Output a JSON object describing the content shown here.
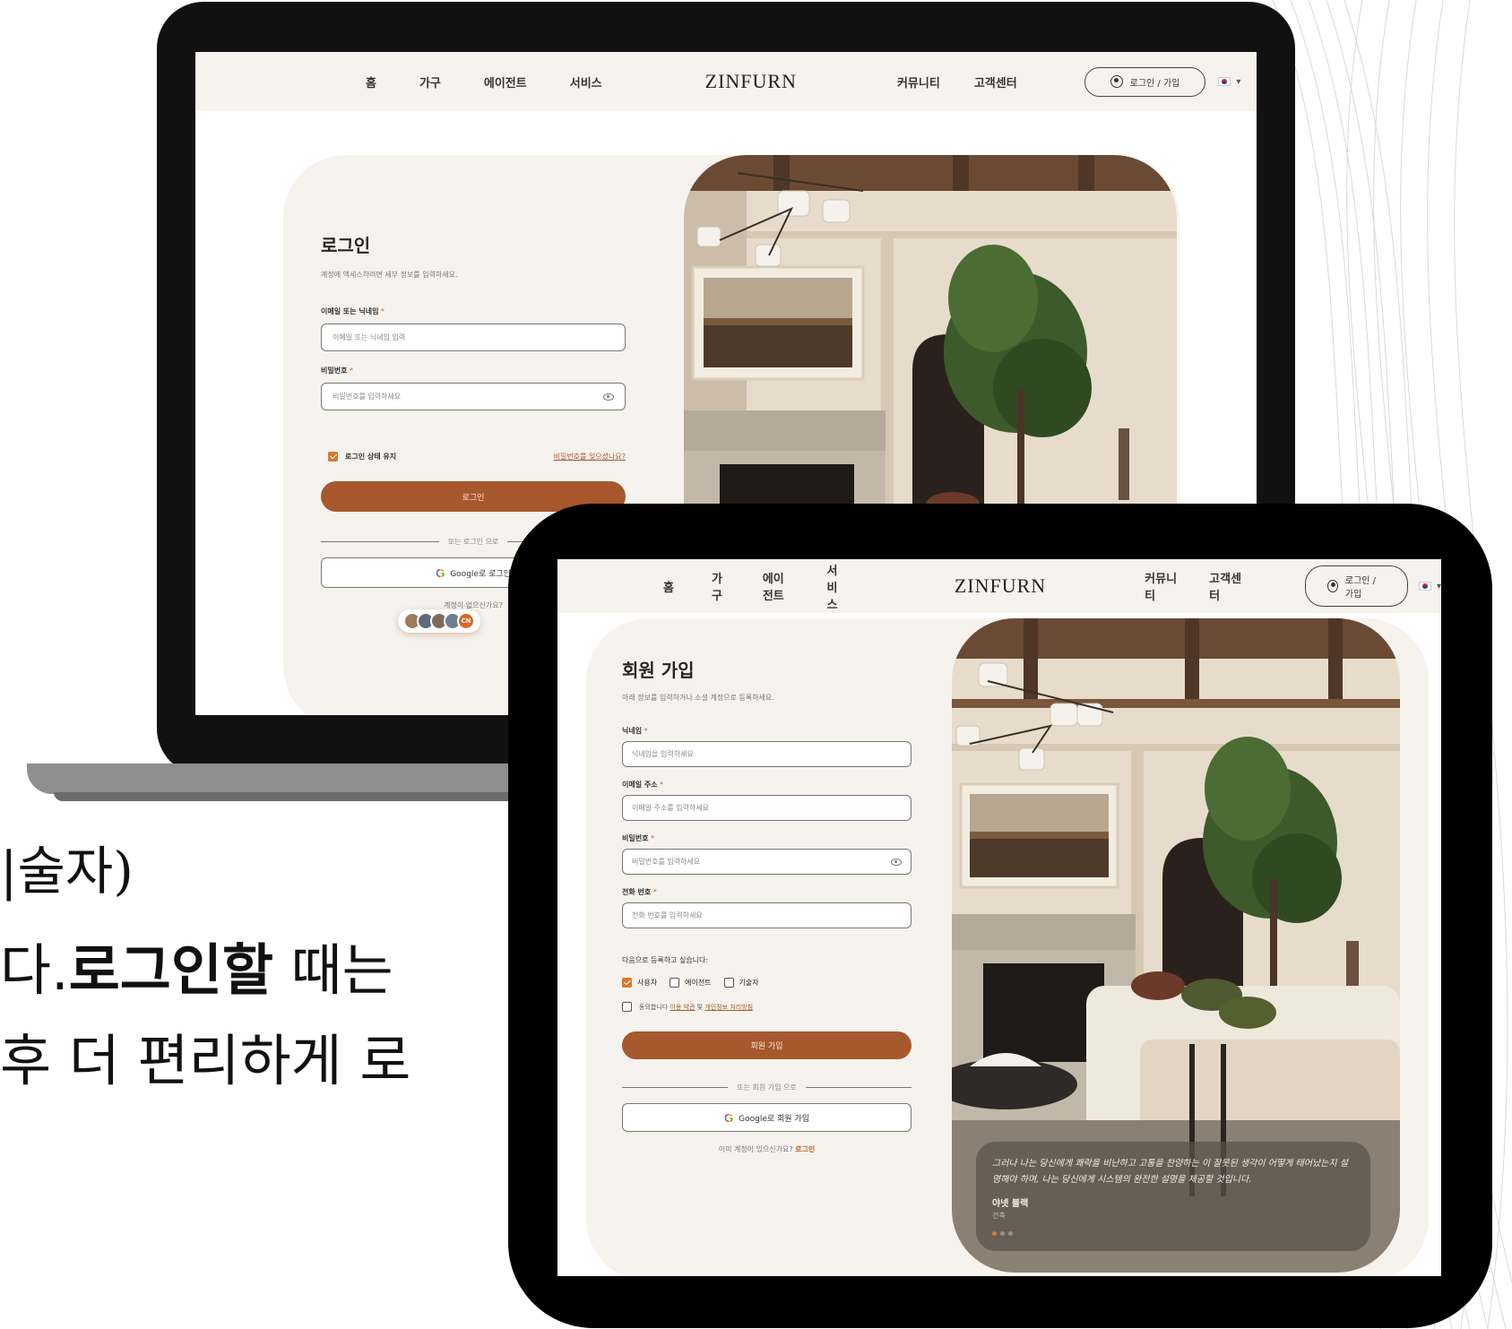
{
  "background_text": {
    "line1": "|술자)",
    "line2_pre": "다.",
    "line2_bold": "로그인할",
    "line2_post": " 때는",
    "line3": "후 더 편리하게 로"
  },
  "nav": {
    "items_left": [
      "홈",
      "가구",
      "에이전트",
      "서비스"
    ],
    "logo": "ZINFURN",
    "items_right": [
      "커뮤니티",
      "고객센터"
    ],
    "account_label": "로그인 / 가입",
    "account_icon": "user-circle-icon",
    "lang_icon": "korea-flag-icon",
    "dropdown_icon": "caret-down-icon"
  },
  "login": {
    "title": "로그인",
    "subtitle": "계정에 액세스하려면 세부 정보를 입력하세요.",
    "email_label": "이메일 또는 닉네임",
    "email_placeholder": "이메일 또는 닉네임 입력",
    "password_label": "비밀번호",
    "password_placeholder": "비밀번호를 입력하세요",
    "remember_label": "로그인 상태 유지",
    "remember_checked": true,
    "forgot_link": "비밀번호를 잊으셨나요?",
    "submit_label": "로그인",
    "divider_label": "또는 로그인 으로",
    "google_label": "Google로 로그인",
    "no_account": "계정이 없으신가요?",
    "avatar_badge": "CN"
  },
  "signup": {
    "title": "회원 가입",
    "subtitle": "아래 정보를 입력하거나 소셜 계정으로 등록하세요.",
    "nickname_label": "닉네임",
    "nickname_placeholder": "닉네임을 입력하세요",
    "email_label": "이메일 주소",
    "email_placeholder": "이메일 주소를 입력하세요",
    "password_label": "비밀번호",
    "password_placeholder": "비밀번호를 입력하세요",
    "phone_label": "전화 번호",
    "phone_placeholder": "전화 번호를 입력하세요",
    "register_as": "다음으로 등록하고 싶습니다:",
    "roles": [
      {
        "label": "사용자",
        "checked": true
      },
      {
        "label": "에이전트",
        "checked": false
      },
      {
        "label": "기술자",
        "checked": false
      }
    ],
    "agree_prefix": "동의합니다",
    "agree_terms": "이용 약관",
    "agree_and": "및",
    "agree_privacy": "개인정보 처리방침",
    "submit_label": "회원 가입",
    "divider_label": "또는 회원 가입 으로",
    "google_label": "Google로 회원 가입",
    "have_account": "이미 계정이 있으신가요?",
    "login_link": "로그인"
  },
  "testimonial": {
    "text": "그러나 나는 당신에게 쾌락을 비난하고 고통을 찬양하는 이 잘못된 생각이 어떻게 태어났는지 설명해야 하며, 나는 당신에게 시스템의 완전한 설명을 제공할 것입니다.",
    "name": "야넷 블랙",
    "role": "건축"
  },
  "colors": {
    "accent": "#a7582c",
    "accent_light": "#d9782f",
    "card_bg": "#f6f3ee"
  }
}
